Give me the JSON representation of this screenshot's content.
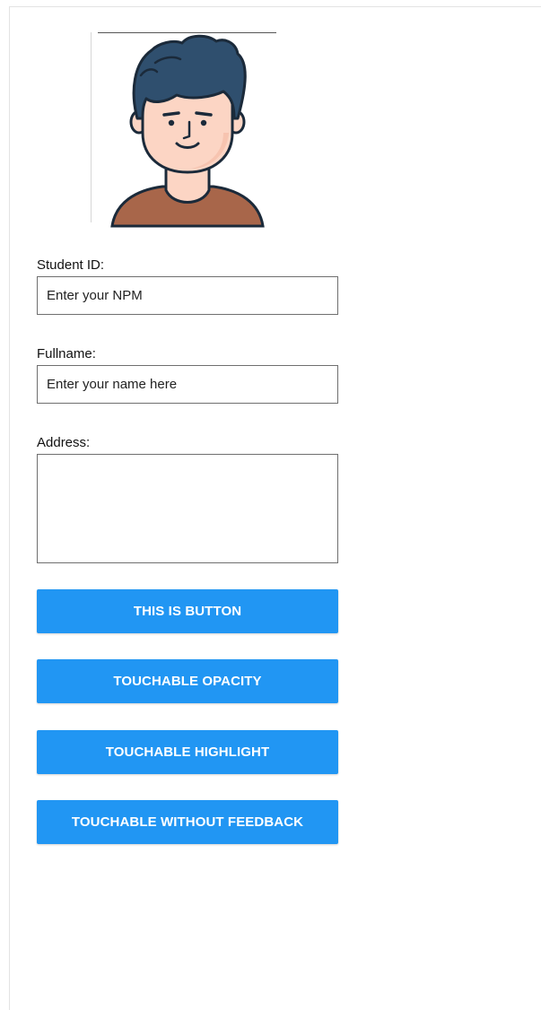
{
  "form": {
    "student_id": {
      "label": "Student ID:",
      "placeholder": "Enter your NPM"
    },
    "fullname": {
      "label": "Fullname:",
      "placeholder": "Enter your name here"
    },
    "address": {
      "label": "Address:",
      "value": ""
    }
  },
  "buttons": {
    "button": "THIS IS BUTTON",
    "touchable_opacity": "TOUCHABLE OPACITY",
    "touchable_highlight": "TOUCHABLE HIGHLIGHT",
    "touchable_without_feedback": "TOUCHABLE WITHOUT FEEDBACK"
  },
  "colors": {
    "button_bg": "#2196f3",
    "button_text": "#ffffff",
    "hair": "#2f4f6e",
    "skin": "#fcd5c4",
    "shirt": "#a8664a",
    "outline": "#1b2a3a"
  },
  "icons": {
    "avatar": "male-student-avatar-icon"
  }
}
